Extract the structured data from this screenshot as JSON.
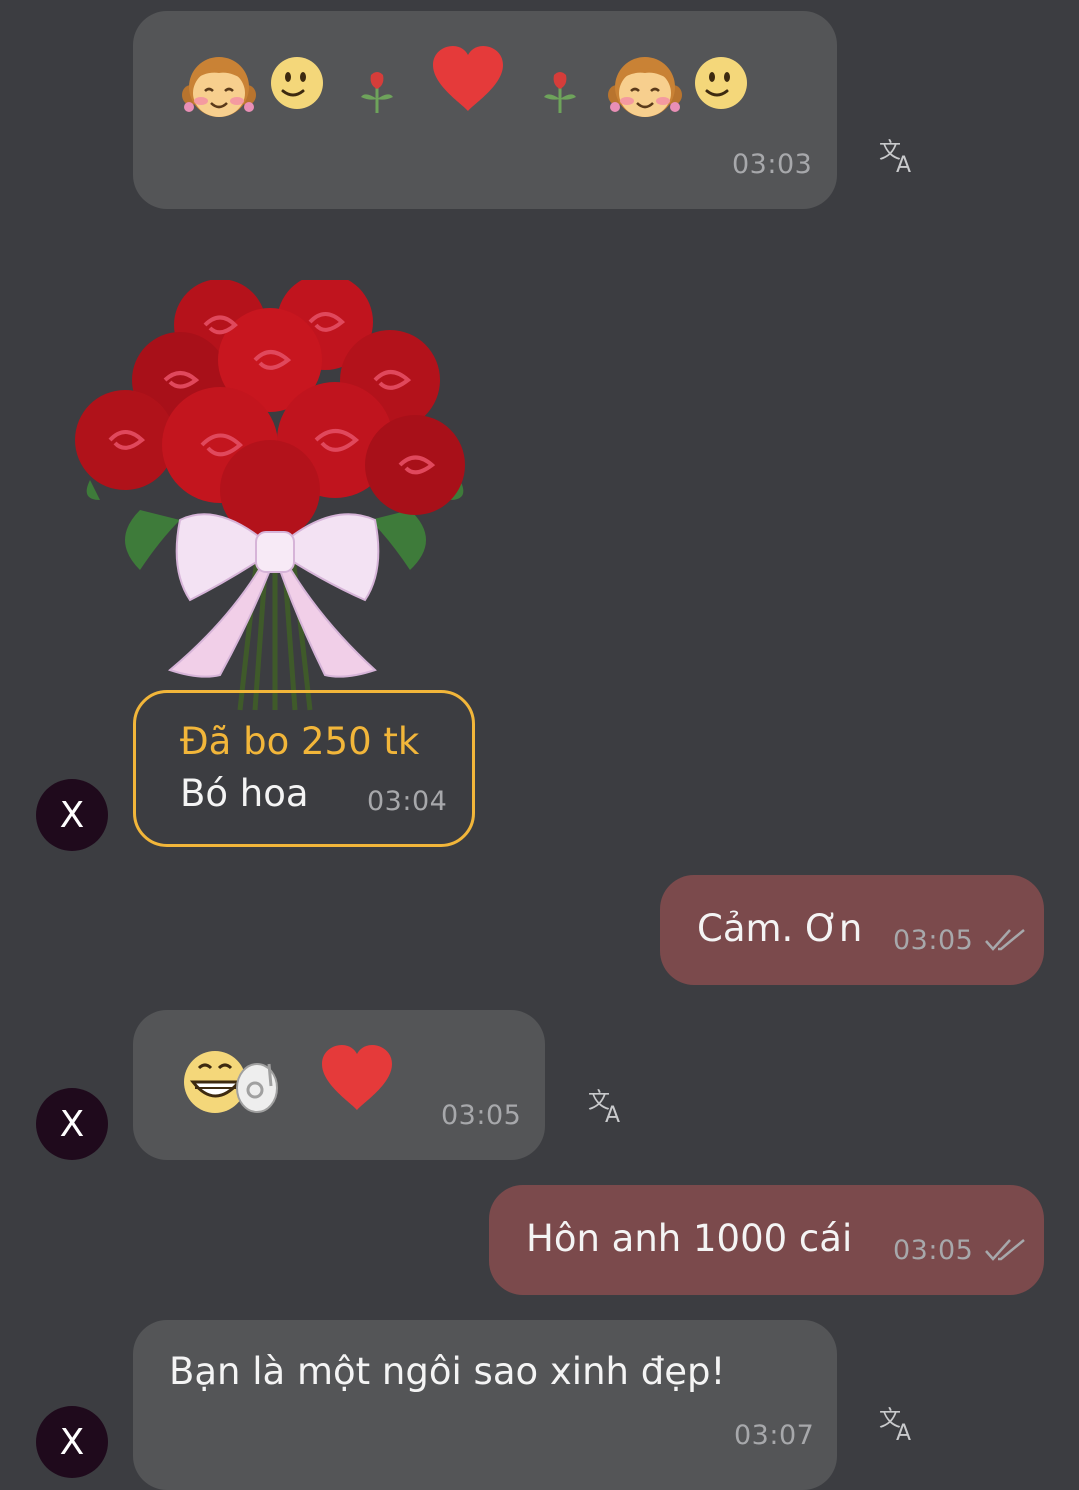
{
  "messages": {
    "m1": {
      "time": "03:03"
    },
    "gift": {
      "title": "Đã bo 250 tk",
      "name": "Bó hoa",
      "time": "03:04"
    },
    "m3": {
      "text": "Cảm. Ơn",
      "time": "03:05"
    },
    "m4": {
      "time": "03:05"
    },
    "m5": {
      "text": "Hôn anh 1000 cái",
      "time": "03:05"
    },
    "m6": {
      "text": "Bạn là một ngôi sao xinh đẹp!",
      "time": "03:07"
    }
  },
  "avatar": {
    "letter": "X"
  },
  "icons": {
    "translate": "translate-icon",
    "read_receipt": "double-check-icon"
  },
  "colors": {
    "background": "#3c3d41",
    "incoming_bubble": "#545557",
    "outgoing_bubble": "#7b4a4c",
    "gift_accent": "#f2b63a",
    "timestamp": "#a7a8ab",
    "avatar": "#1f0a1c"
  }
}
